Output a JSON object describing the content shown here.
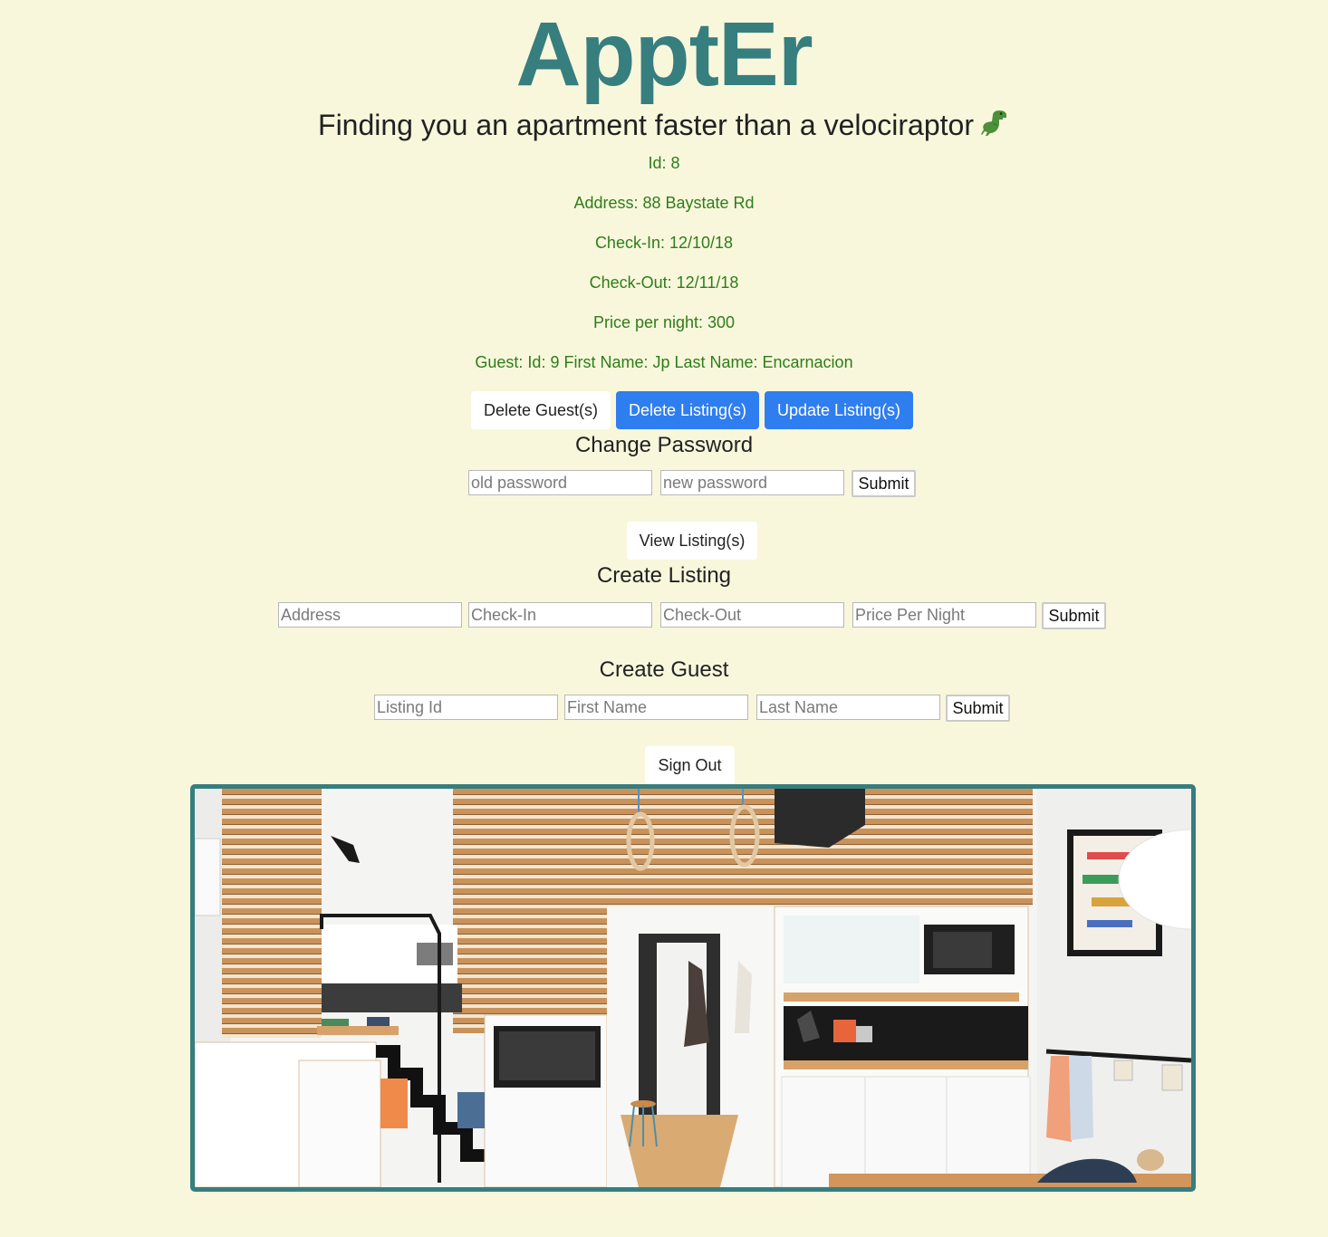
{
  "header": {
    "title": "ApptEr",
    "tagline": "Finding you an apartment faster than a velociraptor"
  },
  "listing": {
    "id_line": "Id: 8",
    "address_line": "Address: 88 Baystate Rd",
    "checkin_line": "Check-In: 12/10/18",
    "checkout_line": "Check-Out: 12/11/18",
    "price_line": "Price per night: 300",
    "guest_line": "Guest: Id: 9 First Name: Jp Last Name: Encarnacion"
  },
  "actions": {
    "delete_guest": "Delete Guest(s)",
    "delete_listing": "Delete Listing(s)",
    "update_listing": "Update Listing(s)",
    "view_listing": "View Listing(s)",
    "sign_out": "Sign Out"
  },
  "change_password": {
    "title": "Change Password",
    "old_placeholder": "old password",
    "new_placeholder": "new password",
    "submit": "Submit"
  },
  "create_listing": {
    "title": "Create Listing",
    "address_placeholder": "Address",
    "checkin_placeholder": "Check-In",
    "checkout_placeholder": "Check-Out",
    "price_placeholder": "Price Per Night",
    "submit": "Submit"
  },
  "create_guest": {
    "title": "Create Guest",
    "listing_id_placeholder": "Listing Id",
    "first_name_placeholder": "First Name",
    "last_name_placeholder": "Last Name",
    "submit": "Submit"
  },
  "colors": {
    "background": "#f8f7dc",
    "brand": "#377e7e",
    "info_text": "#2e7d19",
    "primary_button": "#2f7ef0"
  },
  "icons": {
    "tagline_emoji": "t-rex-icon"
  }
}
